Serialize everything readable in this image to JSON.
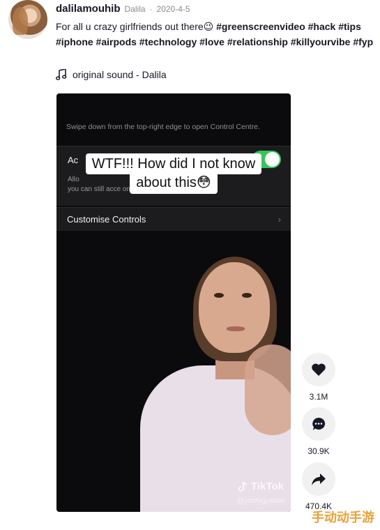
{
  "post": {
    "username": "dalilamouhib",
    "nickname": "Dalila",
    "separator": "·",
    "date": "2020-4-5",
    "caption_text": "For all u crazy girlfriends out there😉 ",
    "hashtags": "#greenscreenvideo #hack #tips #iphone #airpods #technology #love #relationship #killyourvibe #fyp",
    "sound": "original sound - Dalila"
  },
  "video": {
    "control_hint": "Swipe down from the top-right edge to open Control Centre.",
    "row_title": "Ac",
    "row_desc_line1": "Allo",
    "row_desc_line2": "you can still acce                                          ome screen.",
    "customise_label": "Customise Controls",
    "chevron": "›",
    "overlay_line1": "WTF!!! How did I not know",
    "overlay_line2": "about this😳",
    "tiktok_logo": "TikTok",
    "tiktok_user": "@prettygyaldali"
  },
  "actions": {
    "likes": "3.1M",
    "comments": "30.9K",
    "shares": "470.4K"
  },
  "watermark": "手动动手游",
  "colors": {
    "toggle_on": "#34c759",
    "video_bg": "#0b0b0d",
    "action_bg": "#f1f1f2"
  }
}
